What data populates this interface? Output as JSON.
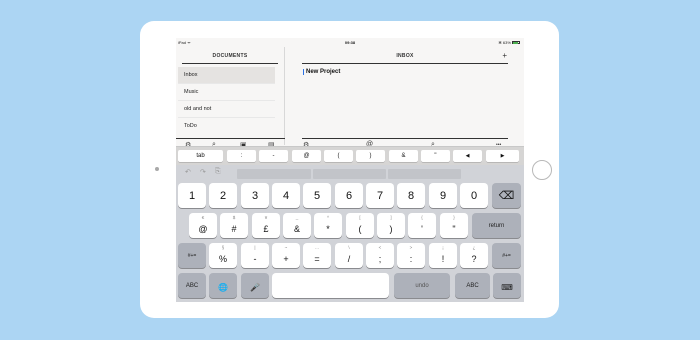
{
  "status": {
    "device": "iPad ᯤ",
    "time": "09:38",
    "battery": "✻ 63%"
  },
  "left_pane": {
    "title": "DOCUMENTS",
    "documents": [
      {
        "label": "Inbox",
        "selected": true
      },
      {
        "label": "Music",
        "selected": false
      },
      {
        "label": "old and not",
        "selected": false
      },
      {
        "label": "ToDo",
        "selected": false
      }
    ],
    "toolbar_icons": [
      "gear-icon",
      "search-icon",
      "tags-icon",
      "document-icon"
    ]
  },
  "right_pane": {
    "title": "INBOX",
    "add_label": "+",
    "editor_text": "New Project",
    "toolbar": {
      "gear": "⚙",
      "at": "@",
      "search": "⌕",
      "more": "•••"
    }
  },
  "accessory_keys": [
    "tab",
    ":",
    "-",
    "@",
    "(",
    ")",
    "&",
    "\"",
    "◀",
    "▶"
  ],
  "keyboard": {
    "undo_icons": [
      "↶",
      "↷",
      "⎘"
    ],
    "number_row": [
      "1",
      "2",
      "3",
      "4",
      "5",
      "6",
      "7",
      "8",
      "9",
      "0"
    ],
    "backspace": "⌫",
    "row2": [
      {
        "alt": "€",
        "main": "@"
      },
      {
        "alt": "$",
        "main": "#"
      },
      {
        "alt": "¥",
        "main": "£"
      },
      {
        "alt": "_",
        "main": "&"
      },
      {
        "alt": "^",
        "main": "*"
      },
      {
        "alt": "[",
        "main": "("
      },
      {
        "alt": "]",
        "main": ")"
      },
      {
        "alt": "{",
        "main": "'"
      },
      {
        "alt": "}",
        "main": "\""
      }
    ],
    "return_label": "return",
    "shift_label": "#+=",
    "row3": [
      {
        "alt": "§",
        "main": "%"
      },
      {
        "alt": "|",
        "main": "-"
      },
      {
        "alt": "~",
        "main": "+"
      },
      {
        "alt": "…",
        "main": "="
      },
      {
        "alt": "\\",
        "main": "/"
      },
      {
        "alt": "<",
        "main": ";"
      },
      {
        "alt": ">",
        "main": ":"
      },
      {
        "alt": "¡",
        "main": "!"
      },
      {
        "alt": "¿",
        "main": "?"
      }
    ],
    "row3_tail": [
      "!",
      "?"
    ],
    "abc_label": "ABC",
    "globe_icon": "🌐",
    "mic_icon": "🎤",
    "space_label": "",
    "undo_label": "undo",
    "hide_keyboard_icon": "⌨"
  }
}
